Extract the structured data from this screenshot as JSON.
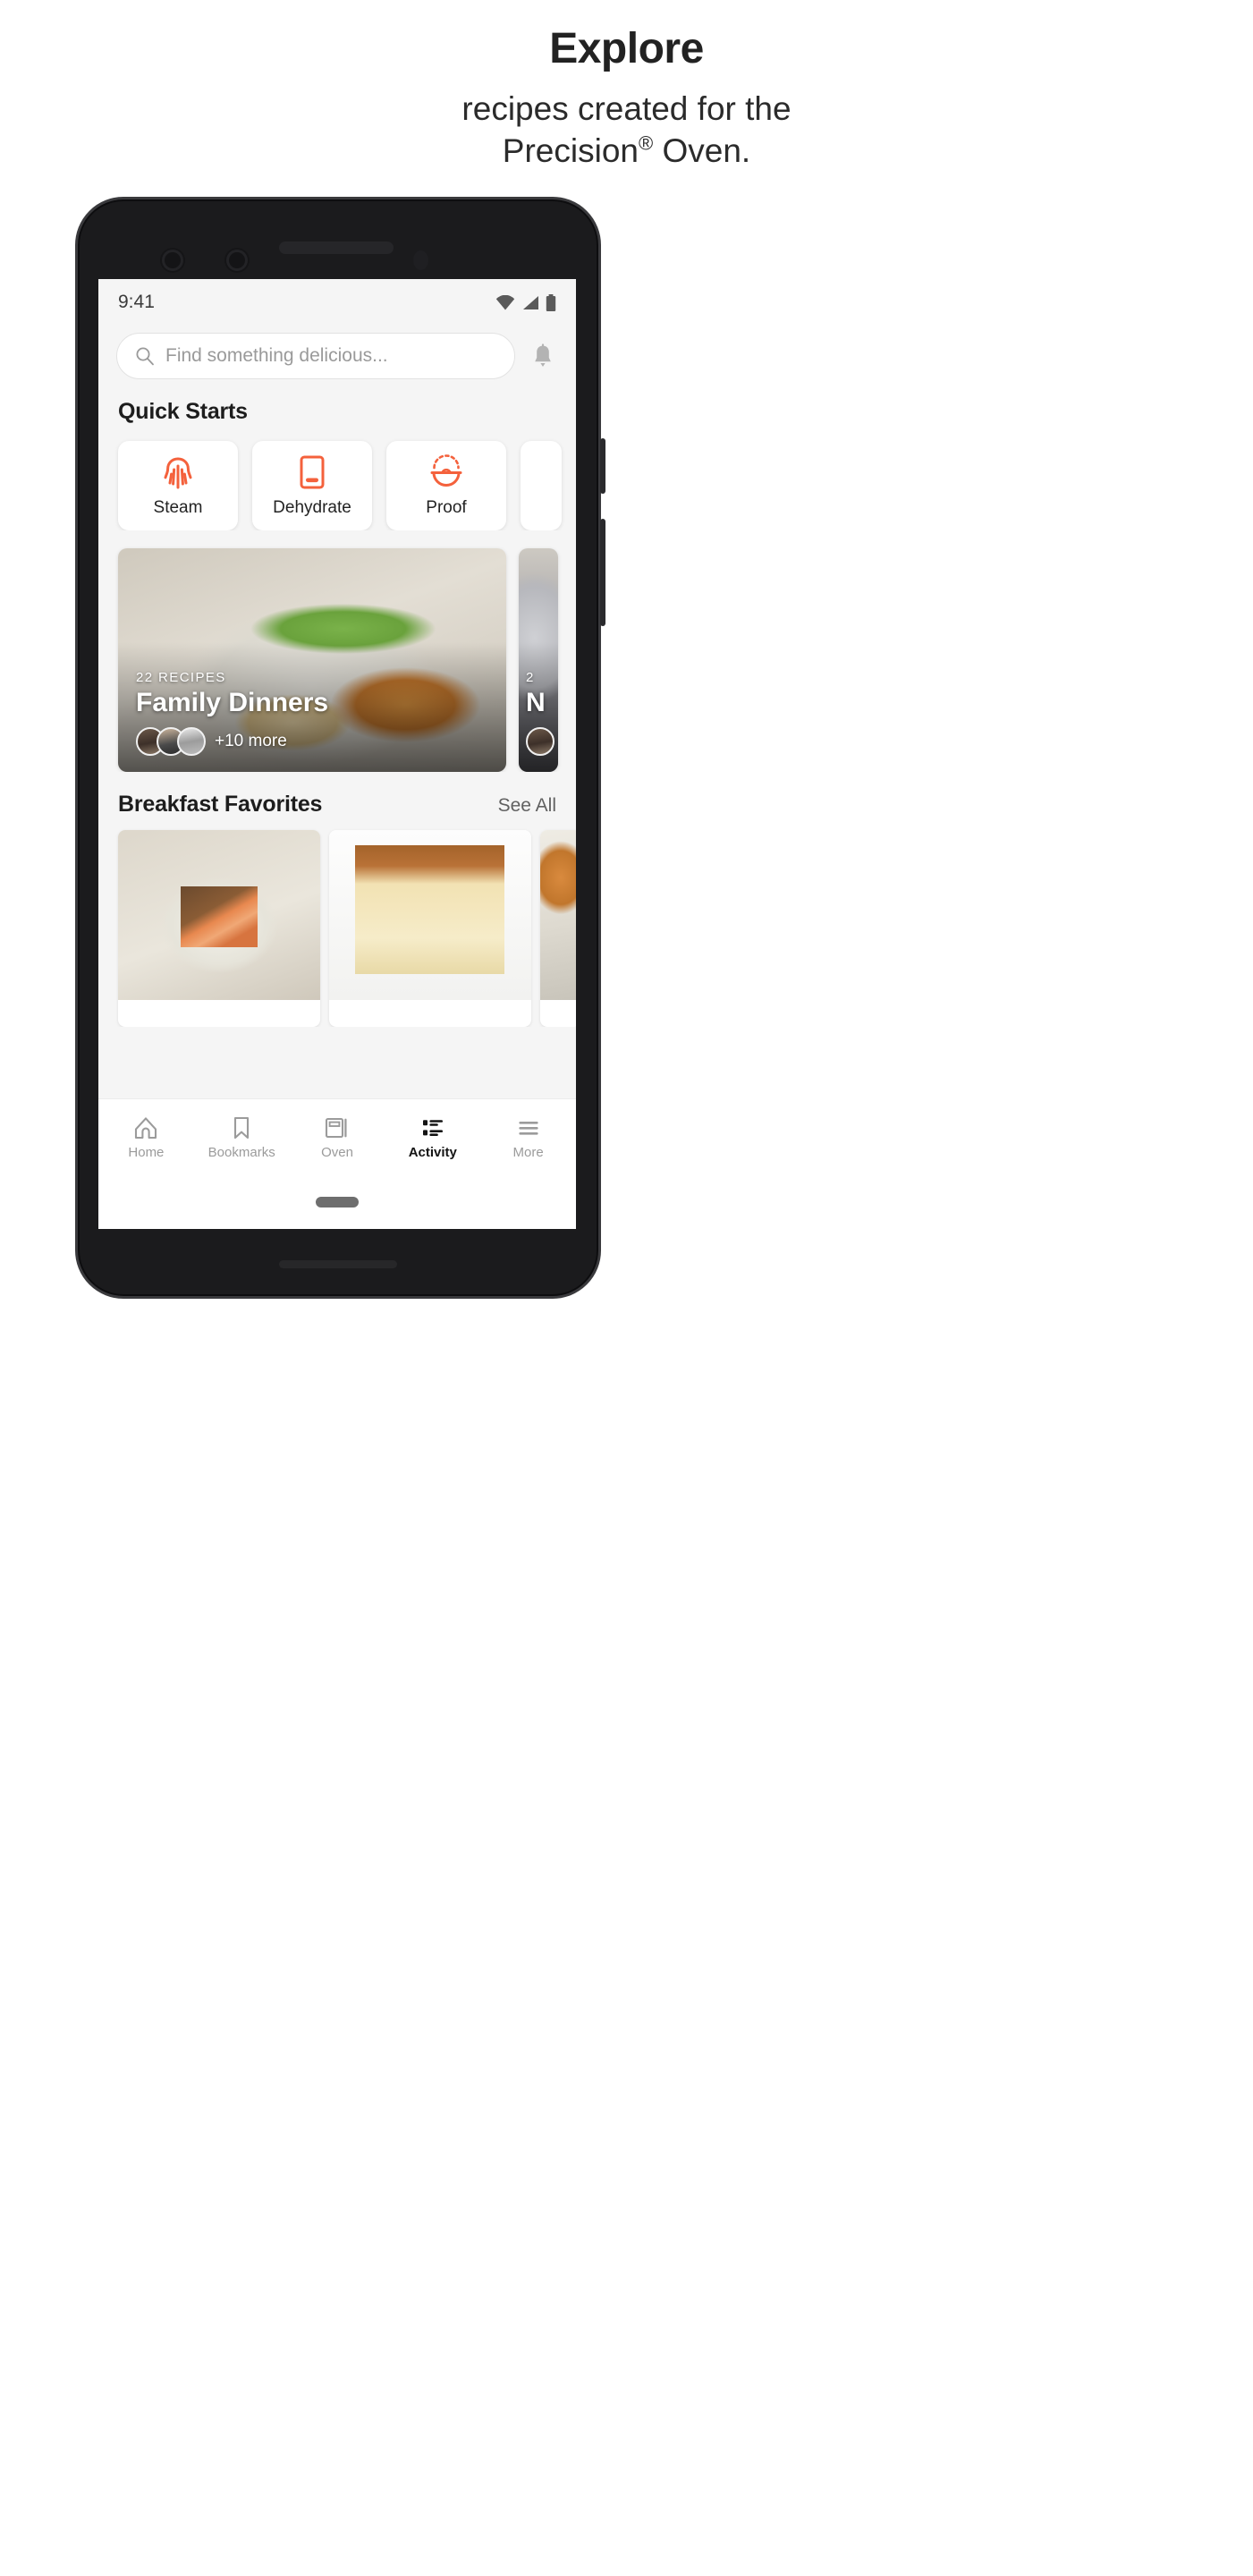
{
  "promo": {
    "title": "Explore",
    "subtitle_line1": "recipes created for the",
    "subtitle_line2_pre": "Precision",
    "subtitle_registered": "®",
    "subtitle_line2_post": " Oven."
  },
  "colors": {
    "accent_orange": "#F4613C",
    "screen_background": "#F5F5F5",
    "card_white": "#FFFFFF",
    "text_primary": "#1D1D1D",
    "text_muted": "#9A9A9A",
    "nav_inactive": "#9B9B9B",
    "nav_active": "#141414"
  },
  "status_bar": {
    "time": "9:41",
    "icons": [
      "wifi-icon",
      "cellular-signal-icon",
      "battery-icon"
    ]
  },
  "search": {
    "placeholder": "Find something delicious...",
    "value": "",
    "icon": "search-icon",
    "notification_icon": "bell-icon"
  },
  "quick_starts": {
    "title": "Quick Starts",
    "items": [
      {
        "label": "Steam",
        "icon": "steam-icon"
      },
      {
        "label": "Dehydrate",
        "icon": "dehydrate-icon"
      },
      {
        "label": "Proof",
        "icon": "proof-icon"
      },
      {
        "label": "",
        "icon": ""
      }
    ]
  },
  "collections": [
    {
      "recipe_count": "22 RECIPES",
      "name": "Family Dinners",
      "more_label": "+10 more",
      "avatar_count": 3,
      "photo": "photo-dinner"
    },
    {
      "recipe_count": "2",
      "name": "N",
      "more_label": "",
      "avatar_count": 1,
      "photo": "photo-night"
    }
  ],
  "breakfast": {
    "title": "Breakfast Favorites",
    "see_all": "See All",
    "tiles": [
      {
        "photo": "photo-salmon"
      },
      {
        "photo": "photo-bread"
      },
      {
        "photo": "photo-roast"
      }
    ]
  },
  "bottom_nav": {
    "items": [
      {
        "label": "Home",
        "icon": "home-icon",
        "active": false
      },
      {
        "label": "Bookmarks",
        "icon": "bookmark-icon",
        "active": false
      },
      {
        "label": "Oven",
        "icon": "oven-icon",
        "active": false
      },
      {
        "label": "Activity",
        "icon": "activity-list-icon",
        "active": true
      },
      {
        "label": "More",
        "icon": "hamburger-menu-icon",
        "active": false
      }
    ]
  },
  "gesture_bar": {
    "icon": "home-indicator-pill"
  }
}
